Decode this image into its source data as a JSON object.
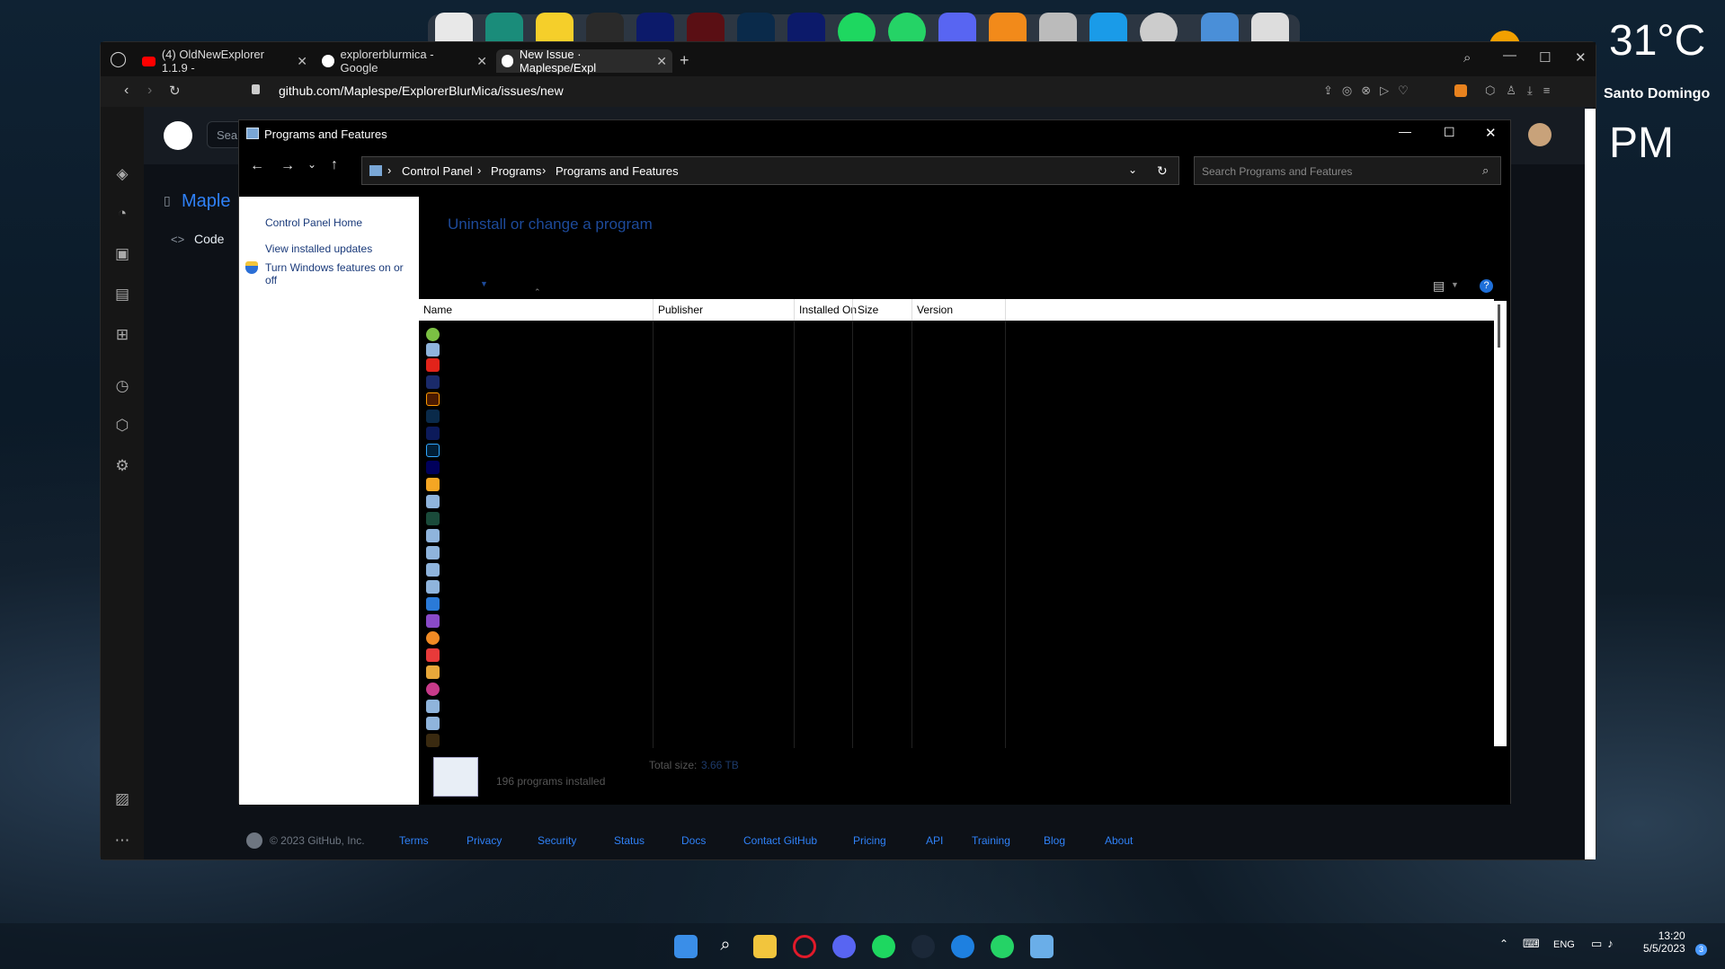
{
  "desktop": {
    "weather_temp": "31°C",
    "weather_city": "Santo Domingo",
    "clock_suffix": "PM"
  },
  "browser": {
    "tabs": [
      {
        "label": "(4) OldNewExplorer 1.1.9 -",
        "icon": "youtube-icon"
      },
      {
        "label": "explorerblurmica - Google",
        "icon": "google-icon"
      },
      {
        "label": "New Issue · Maplespe/Expl",
        "icon": "github-icon"
      }
    ],
    "url": "github.com/Maplespe/ExplorerBlurMica/issues/new",
    "repo_title": "Maple",
    "search_stub": "Sea",
    "tab_code": "Code",
    "footer": {
      "copyright": "© 2023 GitHub, Inc.",
      "links": [
        "Terms",
        "Privacy",
        "Security",
        "Status",
        "Docs",
        "Contact GitHub",
        "Pricing",
        "API",
        "Training",
        "Blog",
        "About"
      ]
    }
  },
  "cp": {
    "title": "Programs and Features",
    "breadcrumb": [
      "Control Panel",
      "Programs",
      "Programs and Features"
    ],
    "search_placeholder": "Search Programs and Features",
    "left_links": [
      "Control Panel Home",
      "View installed updates",
      "Turn Windows features on or off"
    ],
    "heading": "Uninstall or change a program",
    "columns": [
      "Name",
      "Publisher",
      "Installed On",
      "Size",
      "Version"
    ],
    "status": {
      "total_size_label": "Total size:",
      "total_size_value": "3.66 TB",
      "count": "196 programs installed"
    }
  },
  "taskbar": {
    "lang": "ENG",
    "time": "13:20",
    "date": "5/5/2023",
    "badge": "3"
  },
  "colors": {
    "accent": "#2f81f7",
    "cp_link": "#1a3a7a"
  }
}
